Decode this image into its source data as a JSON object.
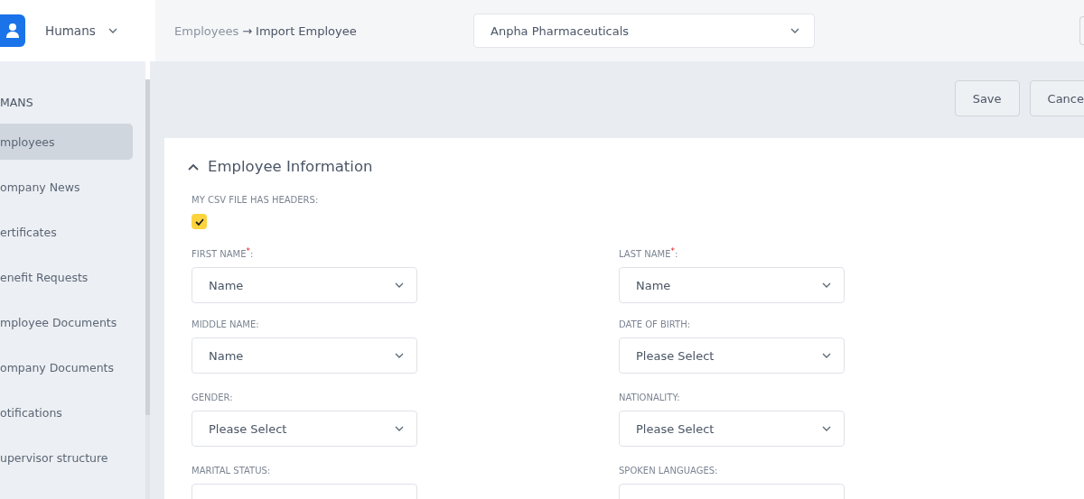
{
  "app_switcher": {
    "label": "Humans"
  },
  "breadcrumb": {
    "parent": "Employees",
    "separator": "→",
    "current": "Import Employee"
  },
  "company_select": {
    "value": "Anpha Pharmaceuticals"
  },
  "sidebar": {
    "heading": "MANS",
    "items": [
      {
        "label": "mployees",
        "selected": true
      },
      {
        "label": "ompany News",
        "selected": false
      },
      {
        "label": "ertificates",
        "selected": false
      },
      {
        "label": "enefit Requests",
        "selected": false
      },
      {
        "label": "mployee Documents",
        "selected": false
      },
      {
        "label": "ompany Documents",
        "selected": false
      },
      {
        "label": "otifications",
        "selected": false
      },
      {
        "label": "upervisor structure",
        "selected": false
      }
    ]
  },
  "actions": [
    "Save",
    "Cance"
  ],
  "section": {
    "title": "Employee Information",
    "expanded": true,
    "headers_option": {
      "label": "MY CSV FILE HAS HEADERS:",
      "checked": true
    },
    "fields": [
      {
        "label": "FIRST NAME$^{*}$:",
        "value": "Name"
      },
      {
        "label": "LAST NAME$^{*}$:",
        "value": "Name"
      },
      {
        "label": "MIDDLE NAME:",
        "value": "Name"
      },
      {
        "label": "DATE OF BIRTH:",
        "value": "Please Select"
      },
      {
        "label": "GENDER:",
        "value": "Please Select"
      },
      {
        "label": "NATIONALITY:",
        "value": "Please Select"
      },
      {
        "label": "MARITAL STATUS:"
      },
      {
        "label": "SPOKEN LANGUAGES:"
      }
    ]
  }
}
